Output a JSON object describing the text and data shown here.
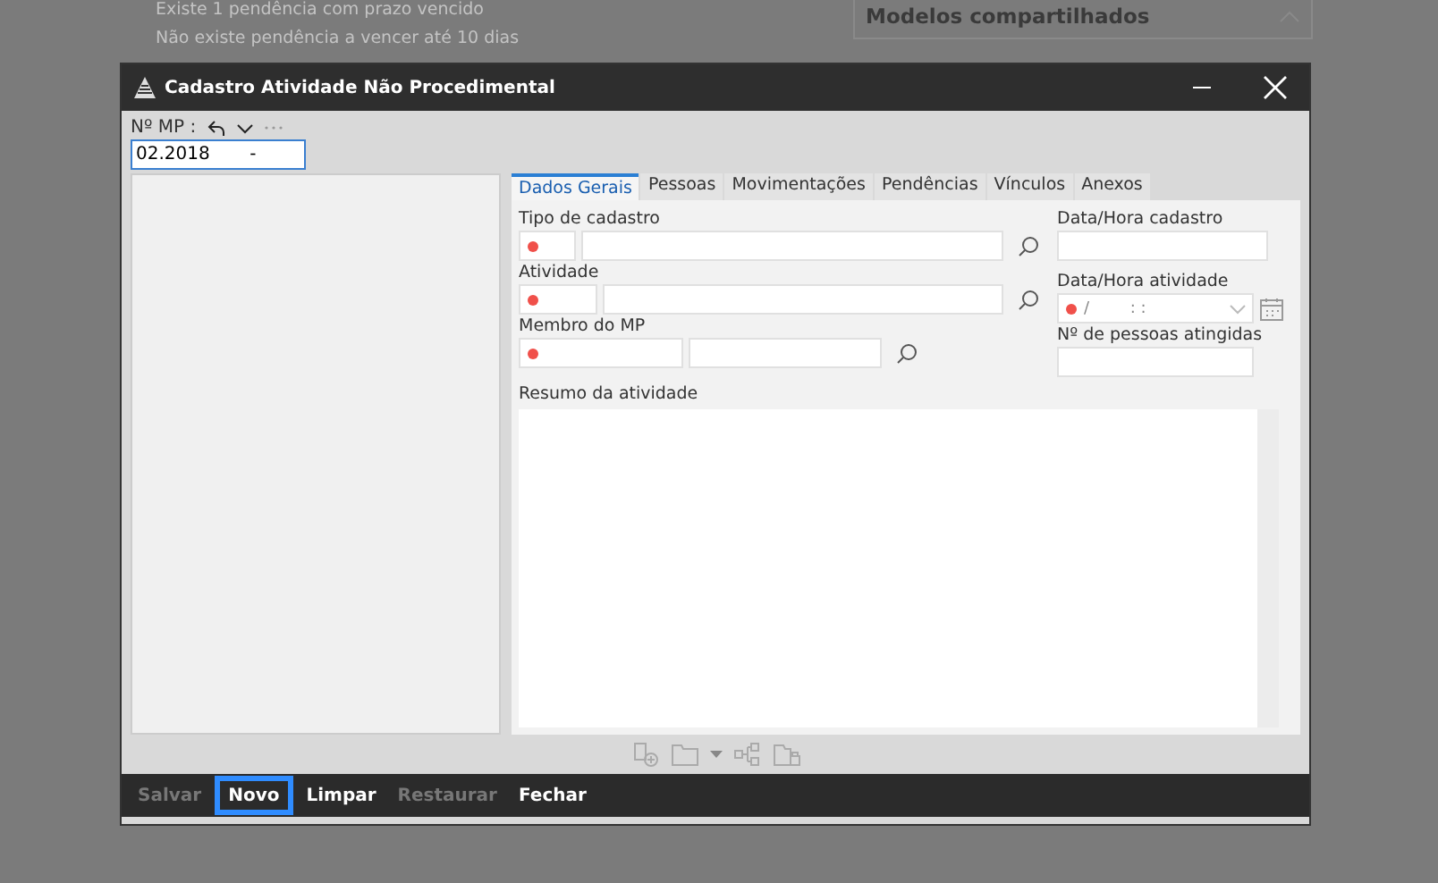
{
  "background": {
    "notices": [
      "Existe 1 pendência com prazo vencido",
      "Não existe pendência a vencer até 10 dias"
    ],
    "panel_title": "Modelos compartilhados"
  },
  "window": {
    "title": "Cadastro Atividade Não Procedimental"
  },
  "mp_field": {
    "label": "Nº MP :",
    "value": "02.2018       -"
  },
  "tabs": [
    {
      "label": "Dados Gerais",
      "selected": true
    },
    {
      "label": "Pessoas",
      "selected": false
    },
    {
      "label": "Movimentações",
      "selected": false
    },
    {
      "label": "Pendências",
      "selected": false
    },
    {
      "label": "Vínculos",
      "selected": false
    },
    {
      "label": "Anexos",
      "selected": false
    }
  ],
  "form": {
    "tipo_de_cadastro": {
      "label": "Tipo de cadastro",
      "required": true
    },
    "atividade": {
      "label": "Atividade",
      "required": true
    },
    "membro_do_mp": {
      "label": "Membro do MP",
      "required": true
    },
    "resumo": {
      "label": "Resumo da atividade"
    },
    "data_hora_cadastro": {
      "label": "Data/Hora cadastro"
    },
    "data_hora_atividade": {
      "label": "Data/Hora atividade",
      "value": "/        : :",
      "required": true
    },
    "pessoas_atingidas": {
      "label": "Nº de pessoas atingidas"
    }
  },
  "buttons": [
    {
      "label": "Salvar",
      "disabled": true,
      "focused": false
    },
    {
      "label": "Novo",
      "disabled": false,
      "focused": true
    },
    {
      "label": "Limpar",
      "disabled": false,
      "focused": false
    },
    {
      "label": "Restaurar",
      "disabled": true,
      "focused": false
    },
    {
      "label": "Fechar",
      "disabled": false,
      "focused": false
    }
  ]
}
